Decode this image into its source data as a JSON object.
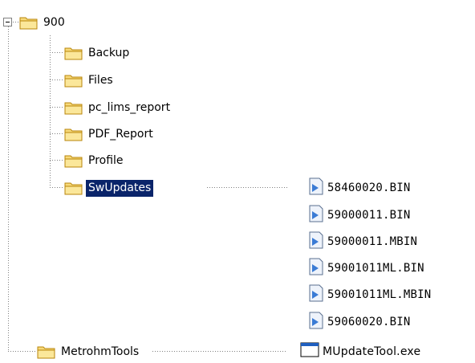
{
  "tree": {
    "root": {
      "label": "900",
      "icon": "folder-open-icon",
      "expander": "collapse-minus-icon"
    },
    "children": [
      {
        "label": "Backup",
        "icon": "folder-icon"
      },
      {
        "label": "Files",
        "icon": "folder-icon"
      },
      {
        "label": "pc_lims_report",
        "icon": "folder-icon"
      },
      {
        "label": "PDF_Report",
        "icon": "folder-icon"
      },
      {
        "label": "Profile",
        "icon": "folder-icon"
      },
      {
        "label": "SwUpdates",
        "icon": "folder-icon",
        "selected": true
      }
    ],
    "swupdates_files": [
      {
        "name": "58460020.BIN",
        "icon": "bin-file-icon"
      },
      {
        "name": "59000011.BIN",
        "icon": "bin-file-icon"
      },
      {
        "name": "59000011.MBIN",
        "icon": "bin-file-icon"
      },
      {
        "name": "59001011ML.BIN",
        "icon": "bin-file-icon"
      },
      {
        "name": "59001011ML.MBIN",
        "icon": "bin-file-icon"
      },
      {
        "name": "59060020.BIN",
        "icon": "bin-file-icon"
      }
    ],
    "sibling": {
      "label": "MetrohmTools",
      "icon": "folder-icon"
    },
    "sibling_files": [
      {
        "name": "MUpdateTool.exe",
        "icon": "exe-window-icon"
      }
    ]
  },
  "colors": {
    "folder_fill": "#f7d97a",
    "folder_edge": "#b8860b",
    "selection": "#0a246a",
    "dotted_line": "#808080",
    "file_icon_blue": "#3a7bd5"
  }
}
